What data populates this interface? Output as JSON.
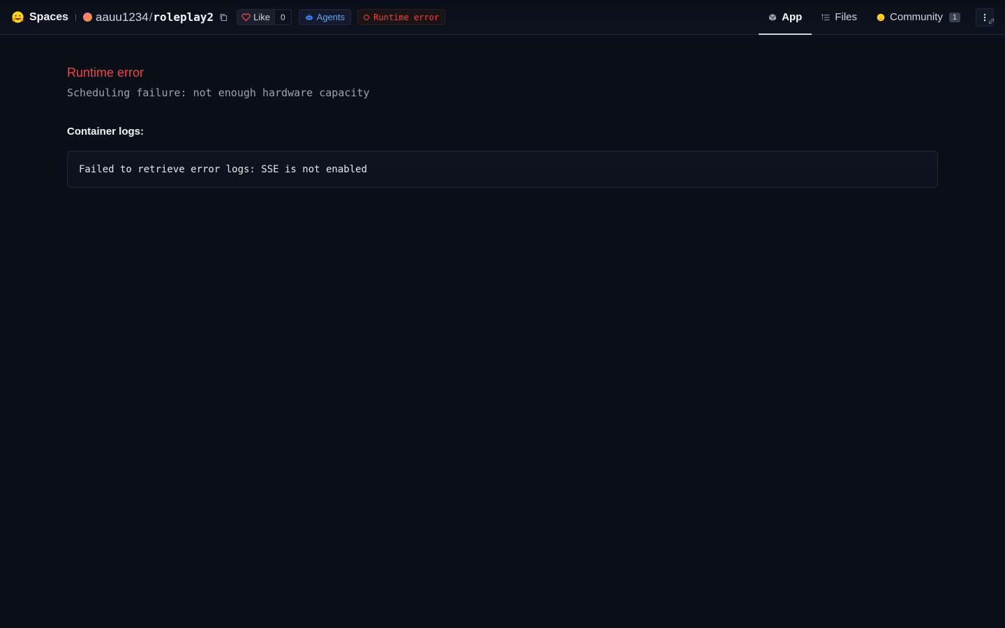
{
  "header": {
    "brand_label": "Spaces",
    "owner": "aauu1234",
    "separator": "/",
    "repo_name": "roleplay2",
    "like_label": "Like",
    "like_count": "0",
    "agents_label": "Agents",
    "status_label": "Runtime error"
  },
  "tabs": [
    {
      "label": "App",
      "icon": "cube-icon",
      "active": true
    },
    {
      "label": "Files",
      "icon": "files-icon",
      "active": false
    },
    {
      "label": "Community",
      "icon": "community-icon",
      "active": false,
      "count": "1"
    }
  ],
  "main": {
    "error_title": "Runtime error",
    "error_message": "Scheduling failure: not enough hardware capacity",
    "logs_label": "Container logs:",
    "logs_text": "Failed to retrieve error logs: SSE is not enabled"
  },
  "colors": {
    "background": "#0b0f19",
    "error": "#ef4444",
    "accent_blue": "#60a5fa",
    "border": "#1f2937"
  }
}
